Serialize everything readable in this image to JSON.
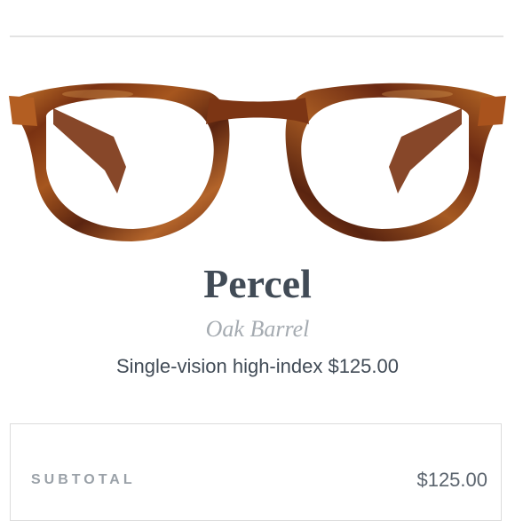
{
  "product": {
    "image_icon": "eyeglasses-image",
    "name": "Percel",
    "color_name": "Oak Barrel",
    "lens_description": "Single-vision high-index $125.00",
    "frame_colors": {
      "tortoise_dark": "#5a2410",
      "tortoise_mid": "#8e3f17",
      "tortoise_light": "#c97a2c"
    }
  },
  "summary": {
    "subtotal_label": "SUBTOTAL",
    "subtotal_value": "$125.00"
  },
  "colors": {
    "title_text": "#414b56",
    "muted_text": "#a5abb1",
    "divider": "#e3e3e3"
  }
}
